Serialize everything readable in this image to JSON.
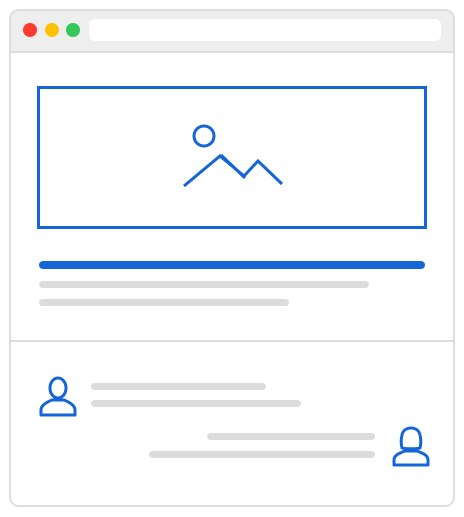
{
  "window": {
    "traffic_lights": {
      "close_color": "#ff3b30",
      "minimize_color": "#ffc107",
      "maximize_color": "#34c759"
    },
    "address_bar_text": ""
  },
  "colors": {
    "accent": "#1565d8",
    "placeholder": "#dcdcdc",
    "border": "#dedede"
  },
  "content": {
    "image_placeholder_icon": "mountain-landscape-icon",
    "headline_placeholder_icon": "text-line-placeholder"
  },
  "comments": [
    {
      "avatar_icon": "male-user-icon",
      "side": "left"
    },
    {
      "avatar_icon": "female-user-icon",
      "side": "right"
    }
  ]
}
